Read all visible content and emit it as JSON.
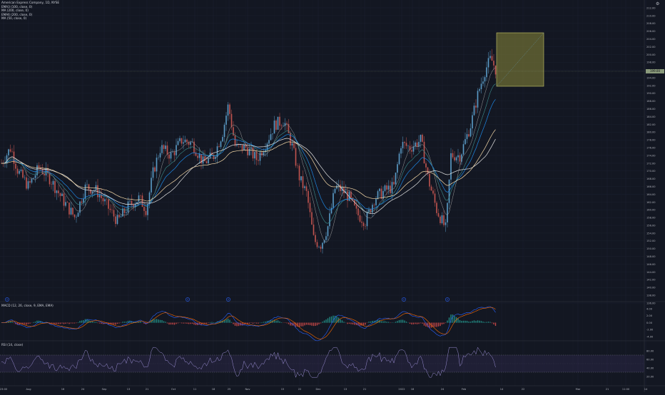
{
  "legend": {
    "title": "American Express Company, 1D, NYSE",
    "lines": [
      "EMA3 (100, close, 0)",
      "MA (200, close, 0)",
      "EMA6 (200, close, 0)",
      "MA (50, close, 0)"
    ]
  },
  "macd_legend": "MACD (12, 26, close, 9, EMA, EMA)",
  "rsi_legend": "RSI (14, close)",
  "price_axis": {
    "labels": [
      "212.00",
      "210.00",
      "208.00",
      "206.00",
      "204.00",
      "202.00",
      "200.00",
      "198.00",
      "196.00",
      "194.00",
      "192.00",
      "190.00",
      "188.00",
      "186.00",
      "184.00",
      "182.00",
      "180.00",
      "178.00",
      "176.00",
      "174.00",
      "172.00",
      "170.00",
      "168.00",
      "166.00",
      "164.00",
      "162.00",
      "160.00",
      "158.00",
      "156.00",
      "154.00",
      "152.00",
      "150.00",
      "148.00",
      "146.00",
      "144.00",
      "142.00",
      "140.00",
      "138.00",
      "136.00"
    ],
    "current_price": "199.00"
  },
  "macd_axis": [
    "4.00",
    "2.00",
    "0.00",
    "-2.00",
    "-4.00"
  ],
  "rsi_axis": [
    "80.00",
    "60.00",
    "40.00",
    "20.00"
  ],
  "time_axis": [
    "23:00",
    "Aug",
    "16",
    "24",
    "Sep",
    "13",
    "21",
    "Oct",
    "11",
    "18",
    "25",
    "Nov",
    "15",
    "22",
    "Dec",
    "13",
    "21",
    "2022",
    "18",
    "24",
    "Feb",
    "14",
    "22",
    "Mar",
    "21",
    "11:00",
    "14"
  ],
  "colors": {
    "background": "#131722",
    "up": "#5b9cc8",
    "down": "#c2544f",
    "ema100": "#1e88e5",
    "ma200": "#e5e5e5",
    "ema200": "#f5d9a8",
    "ma50": "#3d8f8f",
    "macd": "#2962ff",
    "signal": "#ff6d00",
    "rsi": "#9c8fd6",
    "rect_fill": "#8c8a3b",
    "rect_border": "#c9c86a"
  }
}
